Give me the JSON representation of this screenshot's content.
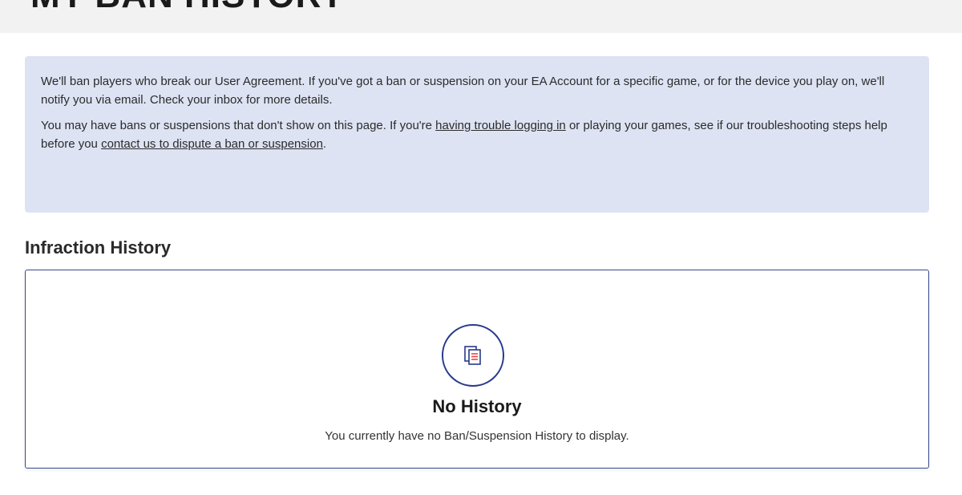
{
  "header": {
    "title": "MY BAN HISTORY"
  },
  "notice": {
    "paragraph1": "We'll ban players who break our User Agreement. If you've got a ban or suspension on your EA Account for a specific game, or for the device you play on, we'll notify you via email. Check your inbox for more details.",
    "paragraph2_before": "You may have bans or suspensions that don't show on this page. If you're ",
    "link_trouble": "having trouble logging in",
    "paragraph2_middle": " or playing your games, see if our troubleshooting steps help before you ",
    "link_contact": "contact us to dispute a ban or suspension",
    "paragraph2_after": "."
  },
  "history": {
    "section_title": "Infraction History",
    "empty_title": "No History",
    "empty_text": "You currently have no Ban/Suspension History to display.",
    "icon": "document-copy-icon"
  },
  "colors": {
    "notice_bg": "#dde3f3",
    "accent_navy": "#283a8a",
    "icon_red": "#e8473f"
  }
}
